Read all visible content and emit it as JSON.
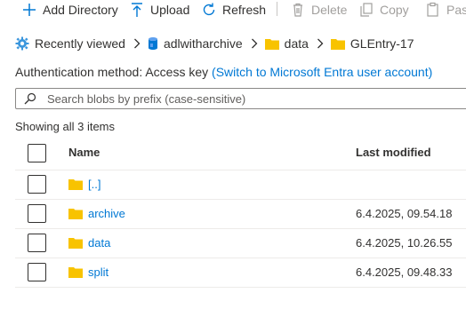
{
  "toolbar": {
    "add_directory": "Add Directory",
    "upload": "Upload",
    "refresh": "Refresh",
    "delete": "Delete",
    "copy": "Copy",
    "paste": "Paste"
  },
  "breadcrumb": {
    "recent": "Recently viewed",
    "account": "adlwitharchive",
    "container": "data",
    "folder": "GLEntry-17"
  },
  "auth": {
    "label": "Authentication method:",
    "value": "Access key",
    "link": "(Switch to Microsoft Entra user account)"
  },
  "search": {
    "placeholder": "Search blobs by prefix (case-sensitive)"
  },
  "status": "Showing all 3 items",
  "table": {
    "col_name": "Name",
    "col_modified": "Last modified",
    "rows": [
      {
        "name": "[..]",
        "modified": ""
      },
      {
        "name": "archive",
        "modified": "6.4.2025, 09.54.18"
      },
      {
        "name": "data",
        "modified": "6.4.2025, 10.26.55"
      },
      {
        "name": "split",
        "modified": "6.4.2025, 09.48.33"
      }
    ]
  },
  "colors": {
    "accent": "#0078d4",
    "folder": "#f8c300",
    "disabled": "#a19f9d"
  }
}
